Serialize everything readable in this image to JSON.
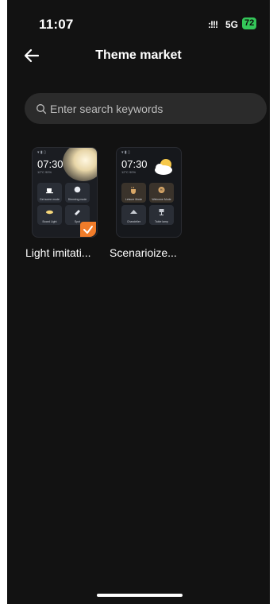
{
  "status": {
    "time": "11:07",
    "signal": ":!!!",
    "network": "5G",
    "battery": "72"
  },
  "header": {
    "title": "Theme market"
  },
  "search": {
    "placeholder": "Enter search keywords"
  },
  "themes": [
    {
      "label": "Light imitati...",
      "selected": true,
      "preview": {
        "time": "07:30",
        "weather": "12°C  90%",
        "tiles": [
          "Get some mode",
          "Dimming mode",
          "Board Light",
          "Spot"
        ]
      }
    },
    {
      "label": "Scenarioize...",
      "selected": false,
      "preview": {
        "time": "07:30",
        "weather": "12°C  90%",
        "tiles": [
          "Leisure Mode",
          "Welcome Mode",
          "Chandelier",
          "Table lamp"
        ]
      }
    }
  ],
  "colors": {
    "background": "#121212",
    "search_bg": "#2b2b2b",
    "accent": "#f07c2a",
    "battery": "#34c759"
  }
}
